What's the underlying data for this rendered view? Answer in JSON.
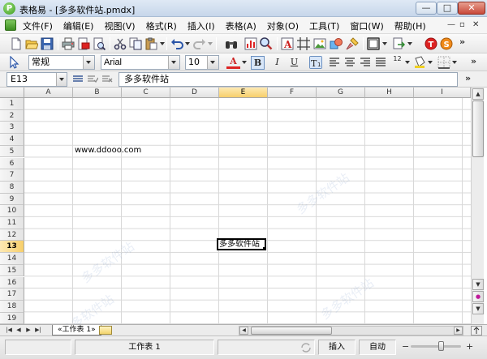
{
  "window": {
    "title": "表格易 - [多多软件站.pmdx]",
    "logo_letter": "P",
    "controls": {
      "minimize": "—",
      "maximize": "□",
      "close": "✕"
    }
  },
  "menu": {
    "items": [
      "文件(F)",
      "编辑(E)",
      "视图(V)",
      "格式(R)",
      "插入(I)",
      "表格(A)",
      "对象(O)",
      "工具(T)",
      "窗口(W)",
      "帮助(H)"
    ],
    "mdi_controls": {
      "minimize": "—",
      "restore": "▫",
      "close": "✕"
    }
  },
  "format_toolbar": {
    "style_value": "常规",
    "font_value": "Arial",
    "size_value": "10",
    "font_color_label": "A",
    "bold_label": "B",
    "italic_label": "I",
    "underline_label": "U",
    "number_format_label": "12",
    "overflow_label": "»"
  },
  "standard_toolbar": {
    "overflow_label": "»"
  },
  "formula_bar": {
    "cell_ref": "E13",
    "content": "多多软件站",
    "overflow_label": "»"
  },
  "grid": {
    "columns": [
      "A",
      "B",
      "C",
      "D",
      "E",
      "F",
      "G",
      "H",
      "I"
    ],
    "active_column": "E",
    "rows": [
      "1",
      "2",
      "3",
      "4",
      "5",
      "6",
      "7",
      "8",
      "9",
      "10",
      "11",
      "12",
      "13",
      "14",
      "15",
      "16",
      "17",
      "18",
      "19"
    ],
    "active_row": "13",
    "cells": [
      {
        "ref": "B5",
        "text": "www.ddooo.com"
      },
      {
        "ref": "E13",
        "text": "多多软件站"
      }
    ]
  },
  "sheet_tabs": {
    "nav_buttons": [
      "|◀",
      "◀",
      "▶",
      "▶|"
    ],
    "tabs": [
      "«工作表 1»"
    ]
  },
  "statusbar": {
    "sheet_name": "工作表 1",
    "mode_insert": "插入",
    "mode_auto": "自动",
    "zoom_minus": "−",
    "zoom_plus": "+"
  },
  "watermark_text": "多多软件站",
  "colors": {
    "accent_active_header": "#f7cf6a",
    "grid_line": "#d8d8d8",
    "app_green": "#3a9a1e"
  }
}
